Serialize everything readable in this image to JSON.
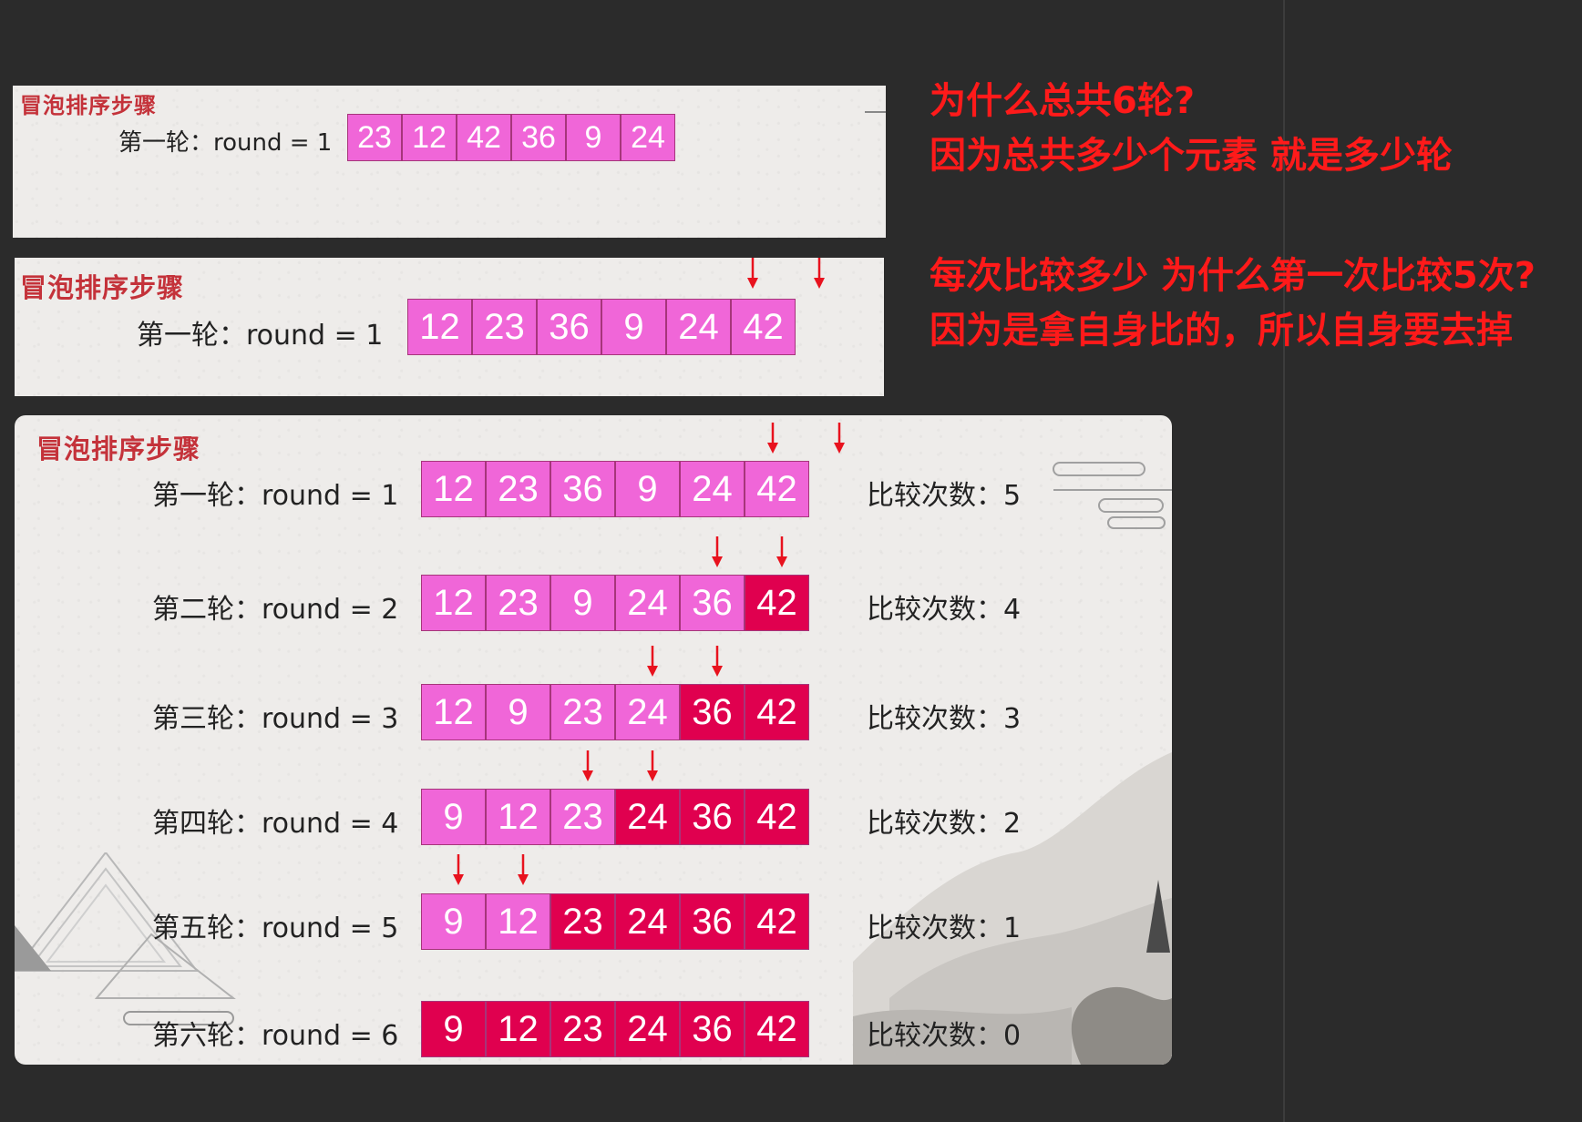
{
  "panel_title": "冒泡排序步骤",
  "round_labels": [
    "第一轮：round = 1",
    "第二轮：round = 2",
    "第三轮：round = 3",
    "第四轮：round = 4",
    "第五轮：round = 5",
    "第六轮：round = 6"
  ],
  "compare_labels": [
    "比较次数：5",
    "比较次数：4",
    "比较次数：3",
    "比较次数：2",
    "比较次数：1",
    "比较次数：0"
  ],
  "panel1": {
    "values": [
      23,
      12,
      42,
      36,
      9,
      24
    ]
  },
  "panel2": {
    "values": [
      12,
      23,
      36,
      9,
      24,
      42
    ]
  },
  "rounds": [
    {
      "values": [
        12,
        23,
        36,
        9,
        24,
        42
      ],
      "sorted_count": 0
    },
    {
      "values": [
        12,
        23,
        9,
        24,
        36,
        42
      ],
      "sorted_count": 1
    },
    {
      "values": [
        12,
        9,
        23,
        24,
        36,
        42
      ],
      "sorted_count": 2
    },
    {
      "values": [
        9,
        12,
        23,
        24,
        36,
        42
      ],
      "sorted_count": 3
    },
    {
      "values": [
        9,
        12,
        23,
        24,
        36,
        42
      ],
      "sorted_count": 4
    },
    {
      "values": [
        9,
        12,
        23,
        24,
        36,
        42
      ],
      "sorted_count": 6
    }
  ],
  "notes": {
    "line1": "为什么总共6轮?",
    "line2": "因为总共多少个元素 就是多少轮",
    "line3": "每次比较多少 为什么第一次比较5次?",
    "line4": "因为是拿自身比的，所以自身要去掉"
  },
  "colors": {
    "unsorted": "#f066d8",
    "sorted": "#e0004f",
    "title": "#c4323a",
    "annotation": "#ff1a1a",
    "arrow": "#e8121e"
  }
}
